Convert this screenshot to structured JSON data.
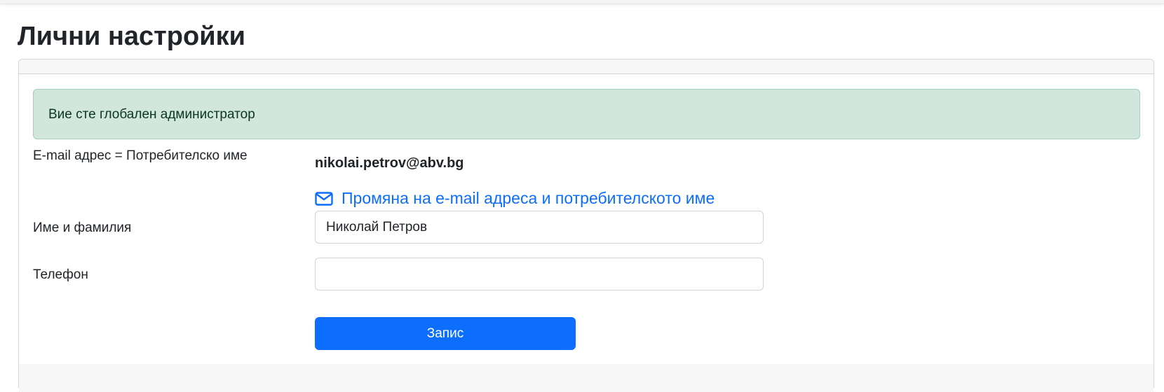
{
  "page": {
    "title": "Лични настройки"
  },
  "alert": {
    "text": "Вие сте глобален администратор"
  },
  "form": {
    "email_label": "E-mail адрес = Потребителско име",
    "email_value": "nikolai.petrov@abv.bg",
    "change_email_link": "Промяна на e-mail адреса и потребителското име",
    "change_email_icon": "envelope-icon",
    "name_label": "Име и фамилия",
    "name_value": "Николай Петров",
    "phone_label": "Телефон",
    "phone_value": "",
    "save_button": "Запис"
  },
  "colors": {
    "primary": "#0d6efd",
    "alert_bg": "#d1e7dd",
    "alert_border": "#a3cfbb"
  }
}
